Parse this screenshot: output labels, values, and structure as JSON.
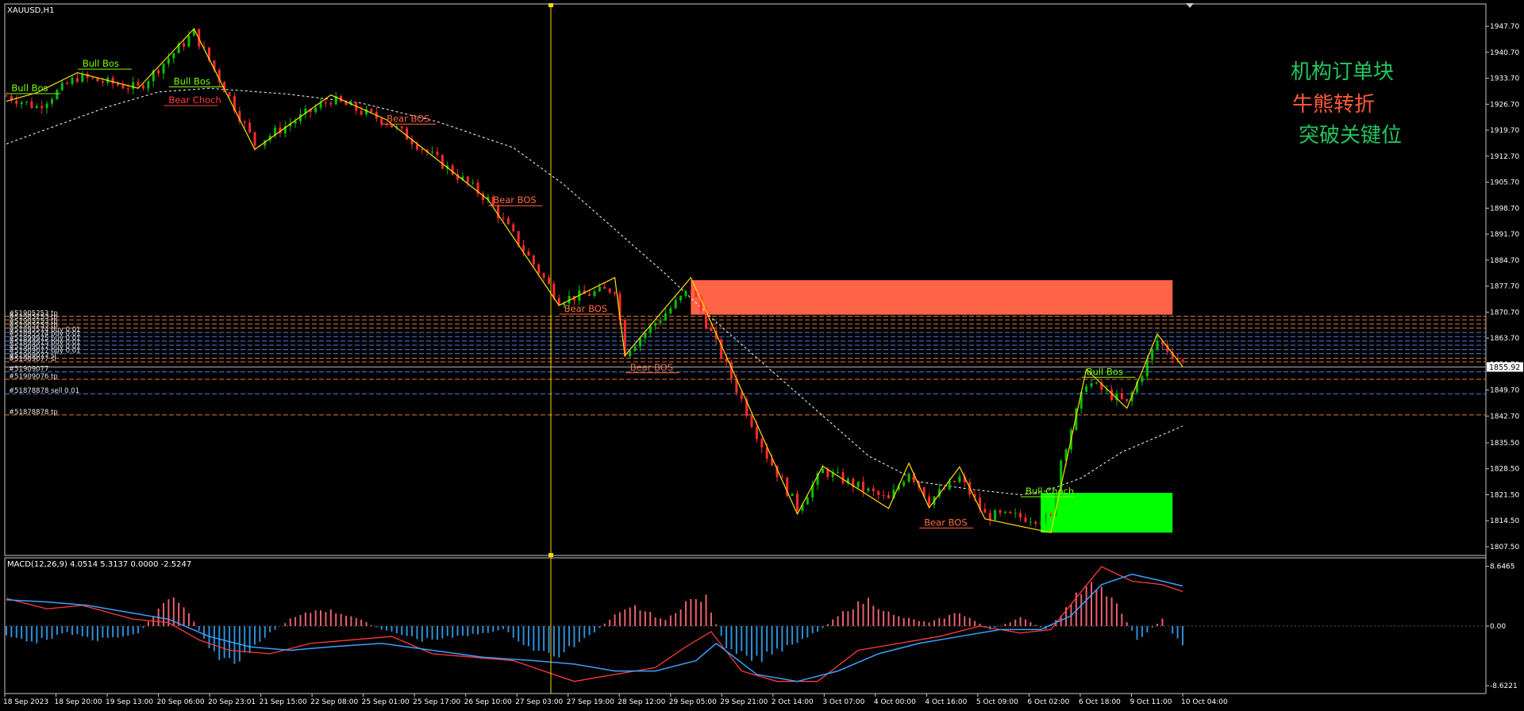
{
  "symbol_label": "XAUUSD,H1",
  "macd_label": "MACD(12,26,9) 4.0514 5.3137 0.0000 -2.5247",
  "annotations_cn": [
    {
      "text": "机构订单块",
      "color": "#22c55e"
    },
    {
      "text": "牛熊转折",
      "color": "#ff5a36"
    },
    {
      "text": "突破关键位",
      "color": "#22c55e"
    }
  ],
  "current_price": "1855.92",
  "price_axis": {
    "ticks": [
      "1947.70",
      "1940.70",
      "1933.70",
      "1926.70",
      "1919.70",
      "1912.70",
      "1905.70",
      "1898.70",
      "1891.70",
      "1884.70",
      "1877.70",
      "1870.70",
      "1863.70",
      "1856.70",
      "1849.70",
      "1842.70",
      "1835.50",
      "1828.50",
      "1821.50",
      "1814.50",
      "1807.50"
    ],
    "max": 1950.5,
    "min": 1806.0
  },
  "macd_axis": {
    "ticks": [
      "8.6465",
      "0.00",
      "-8.6221"
    ],
    "max": 9.3,
    "min": -9.3
  },
  "time_axis": [
    "18 Sep 2023",
    "18 Sep 20:00",
    "19 Sep 13:00",
    "20 Sep 06:00",
    "20 Sep 23:01",
    "21 Sep 15:00",
    "22 Sep 08:00",
    "25 Sep 01:00",
    "25 Sep 17:00",
    "26 Sep 10:00",
    "27 Sep 03:00",
    "27 Sep 19:00",
    "28 Sep 12:00",
    "29 Sep 05:00",
    "29 Sep 21:00",
    "2 Oct 14:00",
    "3 Oct 07:00",
    "4 Oct 00:00",
    "4 Oct 16:00",
    "5 Oct 09:00",
    "6 Oct 02:00",
    "6 Oct 18:00",
    "9 Oct 11:00",
    "10 Oct 04:00"
  ],
  "structure_labels": [
    {
      "text": "Bull Bos",
      "color": "#7fff00",
      "at": [
        1,
        1930.2
      ]
    },
    {
      "text": "Bull Bos",
      "color": "#7fff00",
      "at": [
        15,
        1936.8
      ]
    },
    {
      "text": "Bull Bos",
      "color": "#7fff00",
      "at": [
        33,
        1932.0
      ]
    },
    {
      "text": "Bear Choch",
      "color": "#ff3b3b",
      "at": [
        32,
        1927.0
      ]
    },
    {
      "text": "Bear BOS",
      "color": "#ff6a3d",
      "at": [
        75,
        1922.0
      ]
    },
    {
      "text": "Bear BOS",
      "color": "#ff6a3d",
      "at": [
        96,
        1900.0
      ]
    },
    {
      "text": "Bear BOS",
      "color": "#ff6a3d",
      "at": [
        110,
        1870.8
      ]
    },
    {
      "text": "Bear BOS",
      "color": "#ff6a3d",
      "at": [
        123,
        1855.0
      ]
    },
    {
      "text": "Bear BOS",
      "color": "#ff6a3d",
      "at": [
        181,
        1813.2
      ]
    },
    {
      "text": "Bull Choch",
      "color": "#7fff00",
      "at": [
        201,
        1821.6
      ]
    },
    {
      "text": "Bull Bos",
      "color": "#7fff00",
      "at": [
        213,
        1853.8
      ]
    }
  ],
  "order_lines": [
    {
      "text": "#51905253 tp",
      "price": 1869.6
    },
    {
      "text": "#51905253 tp",
      "price": 1868.6
    },
    {
      "text": "#51905253 tp",
      "price": 1867.5
    },
    {
      "text": "#51905253 tp",
      "price": 1866.4
    },
    {
      "text": "#51895574 buy 0.01",
      "price": 1865.2
    },
    {
      "text": "#51895574 buy 0.01",
      "price": 1864.1
    },
    {
      "text": "#51899975 buy 0.01",
      "price": 1862.9
    },
    {
      "text": "#51899975 buy 0.01",
      "price": 1861.8
    },
    {
      "text": "#51909077 buy 0.01",
      "price": 1860.6
    },
    {
      "text": "#51909077 buy 0.01",
      "price": 1859.5
    },
    {
      "text": "#51909077 sl",
      "price": 1858.3
    },
    {
      "text": "#51909077 sl",
      "price": 1857.3
    },
    {
      "text": "#51909077",
      "price": 1854.6
    },
    {
      "text": "#51909076 tp",
      "price": 1852.6
    },
    {
      "text": "#51878878 sell 0.01",
      "price": 1848.7
    },
    {
      "text": "#51878878 tp",
      "price": 1843.0
    }
  ],
  "order_blocks": [
    {
      "name": "supply-zone",
      "color": "#ff6347",
      "from": 135,
      "to": 230,
      "top": 1879.3,
      "bottom": 1870.0
    },
    {
      "name": "demand-zone",
      "color": "#00ff00",
      "from": 204,
      "to": 230,
      "top": 1822.0,
      "bottom": 1811.3
    }
  ],
  "zigzag": [
    [
      0,
      1927.5
    ],
    [
      6,
      1929.8
    ],
    [
      14,
      1935.2
    ],
    [
      26,
      1931.0
    ],
    [
      37,
      1947.0
    ],
    [
      49,
      1914.5
    ],
    [
      64,
      1929.2
    ],
    [
      75,
      1922.5
    ],
    [
      95,
      1901.0
    ],
    [
      109,
      1872.5
    ],
    [
      120,
      1880.0
    ],
    [
      122,
      1859.0
    ],
    [
      135,
      1880.0
    ],
    [
      156,
      1816.3
    ],
    [
      161,
      1829.2
    ],
    [
      174,
      1817.8
    ],
    [
      178,
      1830.0
    ],
    [
      182,
      1818.0
    ],
    [
      188,
      1829.0
    ],
    [
      193,
      1815.0
    ],
    [
      206,
      1811.3
    ],
    [
      213,
      1855.3
    ],
    [
      221,
      1844.8
    ],
    [
      227,
      1864.8
    ],
    [
      232,
      1856.0
    ]
  ],
  "price_path": [
    [
      0,
      1929
    ],
    [
      6,
      1926
    ],
    [
      14,
      1934
    ],
    [
      26,
      1931
    ],
    [
      37,
      1946
    ],
    [
      49,
      1916
    ],
    [
      64,
      1928
    ],
    [
      75,
      1922
    ],
    [
      80,
      1917
    ],
    [
      95,
      1901
    ],
    [
      109,
      1874
    ],
    [
      120,
      1877
    ],
    [
      122,
      1860
    ],
    [
      135,
      1877
    ],
    [
      150,
      1832
    ],
    [
      156,
      1818
    ],
    [
      161,
      1828
    ],
    [
      174,
      1820
    ],
    [
      178,
      1828
    ],
    [
      182,
      1820
    ],
    [
      188,
      1826
    ],
    [
      193,
      1816
    ],
    [
      206,
      1815
    ],
    [
      208,
      1831
    ],
    [
      213,
      1852
    ],
    [
      221,
      1846
    ],
    [
      227,
      1863
    ],
    [
      232,
      1857
    ]
  ],
  "ma_path": [
    [
      0,
      1916
    ],
    [
      10,
      1921
    ],
    [
      20,
      1926
    ],
    [
      30,
      1930
    ],
    [
      40,
      1931
    ],
    [
      55,
      1929.5
    ],
    [
      70,
      1927
    ],
    [
      85,
      1922
    ],
    [
      100,
      1915
    ],
    [
      110,
      1905
    ],
    [
      120,
      1893
    ],
    [
      130,
      1881
    ],
    [
      140,
      1868
    ],
    [
      150,
      1856
    ],
    [
      160,
      1844
    ],
    [
      170,
      1832
    ],
    [
      180,
      1825
    ],
    [
      190,
      1823
    ],
    [
      200,
      1821.5
    ],
    [
      205,
      1822.5
    ],
    [
      212,
      1826
    ],
    [
      220,
      1833
    ],
    [
      232,
      1840
    ]
  ],
  "macd_hist": [
    [
      0,
      -1.5
    ],
    [
      6,
      -2.2
    ],
    [
      12,
      -1.0
    ],
    [
      18,
      -2.0
    ],
    [
      26,
      -1.2
    ],
    [
      30,
      2.5
    ],
    [
      33,
      4.5
    ],
    [
      36,
      2.0
    ],
    [
      40,
      -3.5
    ],
    [
      45,
      -5.5
    ],
    [
      50,
      -2.0
    ],
    [
      56,
      1.0
    ],
    [
      62,
      2.5
    ],
    [
      68,
      1.5
    ],
    [
      74,
      -0.5
    ],
    [
      82,
      -2.0
    ],
    [
      90,
      -1.5
    ],
    [
      98,
      -0.5
    ],
    [
      103,
      -3.0
    ],
    [
      108,
      -4.5
    ],
    [
      114,
      -2.0
    ],
    [
      120,
      1.5
    ],
    [
      124,
      2.8
    ],
    [
      130,
      0.8
    ],
    [
      134,
      3.5
    ],
    [
      138,
      4.0
    ],
    [
      142,
      -3.5
    ],
    [
      148,
      -5.0
    ],
    [
      155,
      -2.5
    ],
    [
      160,
      -0.8
    ],
    [
      166,
      2.5
    ],
    [
      170,
      3.8
    ],
    [
      175,
      1.5
    ],
    [
      182,
      0.5
    ],
    [
      188,
      2.0
    ],
    [
      194,
      -0.5
    ],
    [
      200,
      1.2
    ],
    [
      205,
      -0.5
    ],
    [
      209,
      2.5
    ],
    [
      214,
      7.0
    ],
    [
      219,
      3.0
    ],
    [
      223,
      -2.0
    ],
    [
      228,
      1.0
    ],
    [
      232,
      -3.0
    ]
  ],
  "macd_main": [
    [
      0,
      4.0
    ],
    [
      8,
      2.5
    ],
    [
      15,
      3.0
    ],
    [
      25,
      1.0
    ],
    [
      32,
      0.5
    ],
    [
      38,
      -2.0
    ],
    [
      44,
      -3.5
    ],
    [
      52,
      -4.0
    ],
    [
      60,
      -2.5
    ],
    [
      68,
      -2.0
    ],
    [
      76,
      -1.5
    ],
    [
      84,
      -4.0
    ],
    [
      92,
      -4.5
    ],
    [
      100,
      -5.0
    ],
    [
      106,
      -6.5
    ],
    [
      112,
      -8.0
    ],
    [
      120,
      -7.0
    ],
    [
      128,
      -6.0
    ],
    [
      134,
      -3.0
    ],
    [
      139,
      -0.8
    ],
    [
      145,
      -6.5
    ],
    [
      152,
      -8.0
    ],
    [
      160,
      -8.0
    ],
    [
      168,
      -3.5
    ],
    [
      176,
      -2.5
    ],
    [
      184,
      -1.5
    ],
    [
      192,
      0.0
    ],
    [
      200,
      -1.0
    ],
    [
      206,
      -0.5
    ],
    [
      212,
      5.0
    ],
    [
      216,
      8.6
    ],
    [
      222,
      6.5
    ],
    [
      228,
      6.0
    ],
    [
      232,
      5.0
    ]
  ],
  "macd_signal": [
    [
      0,
      3.8
    ],
    [
      8,
      3.5
    ],
    [
      16,
      3.0
    ],
    [
      24,
      2.0
    ],
    [
      32,
      1.0
    ],
    [
      40,
      -1.5
    ],
    [
      48,
      -3.0
    ],
    [
      56,
      -3.5
    ],
    [
      64,
      -3.0
    ],
    [
      74,
      -2.5
    ],
    [
      84,
      -3.5
    ],
    [
      94,
      -4.5
    ],
    [
      104,
      -5.0
    ],
    [
      112,
      -5.5
    ],
    [
      120,
      -6.5
    ],
    [
      128,
      -6.5
    ],
    [
      136,
      -5.0
    ],
    [
      140,
      -2.5
    ],
    [
      148,
      -7.0
    ],
    [
      156,
      -8.0
    ],
    [
      164,
      -6.5
    ],
    [
      172,
      -4.0
    ],
    [
      180,
      -2.5
    ],
    [
      188,
      -1.5
    ],
    [
      196,
      -0.5
    ],
    [
      204,
      -0.5
    ],
    [
      210,
      1.5
    ],
    [
      216,
      6.0
    ],
    [
      222,
      7.5
    ],
    [
      228,
      6.5
    ],
    [
      232,
      5.8
    ]
  ]
}
